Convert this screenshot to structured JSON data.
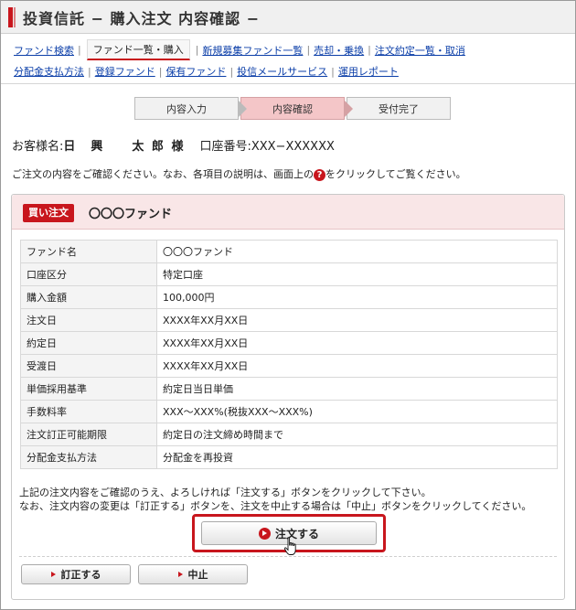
{
  "page": {
    "title": "投資信託 − 購入注文 内容確認 −"
  },
  "nav": {
    "row1": [
      "ファンド検索",
      "ファンド一覧・購入",
      "新規募集ファンド一覧",
      "売却・乗換",
      "注文約定一覧・取消"
    ],
    "row2": [
      "分配金支払方法",
      "登録ファンド",
      "保有ファンド",
      "投信メールサービス",
      "運用レポート"
    ],
    "active": "ファンド一覧・購入"
  },
  "steps": {
    "labels": [
      "内容入力",
      "内容確認",
      "受付完了"
    ],
    "current": "内容確認"
  },
  "customer": {
    "label": "お客様名:",
    "name": "日　興　　太 郎 様",
    "account": "口座番号:XXX−XXXXXX"
  },
  "notice": {
    "before": "ご注文の内容をご確認ください。なお、各項目の説明は、画面上の",
    "icon": "?",
    "after": "をクリックしてご覧ください。"
  },
  "order": {
    "badge": "買い注文",
    "fund": "〇〇〇ファンド",
    "rows": [
      {
        "key": "ファンド名",
        "value": "〇〇〇ファンド"
      },
      {
        "key": "口座区分",
        "value": "特定口座"
      },
      {
        "key": "購入金額",
        "value": "100,000円"
      },
      {
        "key": "注文日",
        "value": "XXXX年XX月XX日"
      },
      {
        "key": "約定日",
        "value": "XXXX年XX月XX日"
      },
      {
        "key": "受渡日",
        "value": "XXXX年XX月XX日"
      },
      {
        "key": "単価採用基準",
        "value": "約定日当日単価"
      },
      {
        "key": "手数料率",
        "value": "XXX〜XXX%(税抜XXX〜XXX%)"
      },
      {
        "key": "注文訂正可能期限",
        "value": "約定日の注文締め時間まで"
      },
      {
        "key": "分配金支払方法",
        "value": "分配金を再投資"
      }
    ]
  },
  "message": {
    "line1": "上記の注文内容をご確認のうえ、よろしければ「注文する」ボタンをクリックして下さい。",
    "line2": "なお、注文内容の変更は「訂正する」ボタンを、注文を中止する場合は「中止」ボタンをクリックしてください。"
  },
  "buttons": {
    "order": "注文する",
    "revise": "訂正する",
    "cancel": "中止"
  },
  "colors": {
    "accent": "#c8161d",
    "stepCurrent": "#f4c6c8",
    "panelHead": "#f9e6e7",
    "link": "#0b3ea8"
  }
}
